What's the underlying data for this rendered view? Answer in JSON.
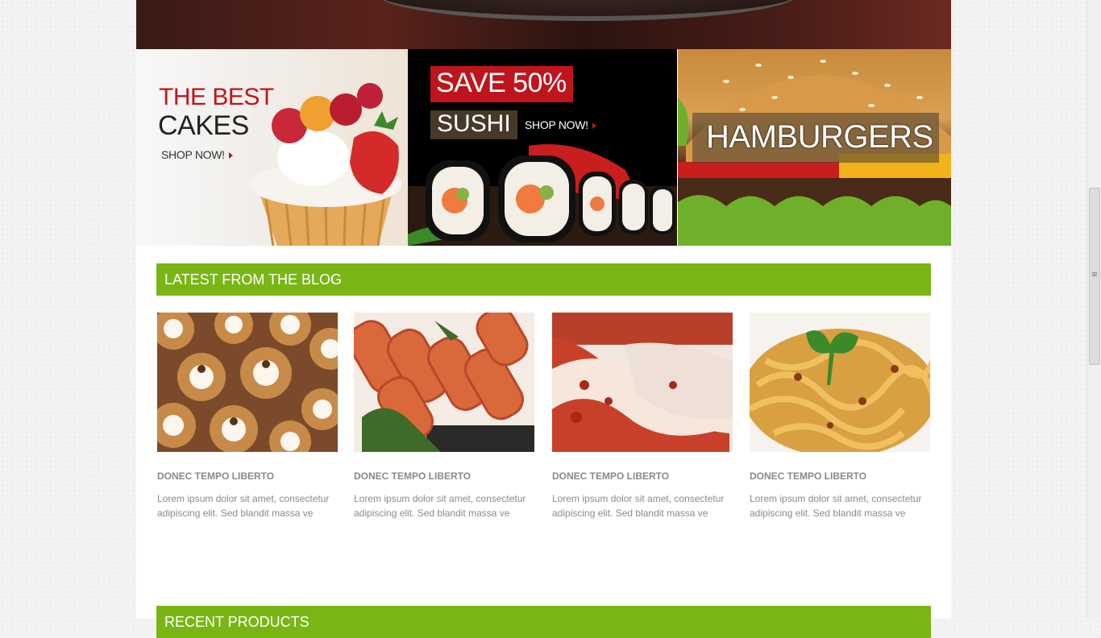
{
  "banners": {
    "cakes": {
      "line1": "THE BEST",
      "line2": "CAKES",
      "cta": "SHOP NOW!"
    },
    "sushi": {
      "badge": "SAVE 50%",
      "title": "SUSHI",
      "cta": "SHOP NOW!"
    },
    "burgers": {
      "title": "HAMBURGERS"
    }
  },
  "blog": {
    "heading": "LATEST FROM THE BLOG",
    "posts": [
      {
        "title": "DONEC TEMPO LIBERTO",
        "excerpt": "Lorem ipsum dolor sit amet, consectetur adipiscing elit. Sed blandit massa ve"
      },
      {
        "title": "DONEC TEMPO LIBERTO",
        "excerpt": "Lorem ipsum dolor sit amet, consectetur adipiscing elit. Sed blandit massa ve"
      },
      {
        "title": "DONEC TEMPO LIBERTO",
        "excerpt": "Lorem ipsum dolor sit amet, consectetur adipiscing elit. Sed blandit massa ve"
      },
      {
        "title": "DONEC TEMPO LIBERTO",
        "excerpt": "Lorem ipsum dolor sit amet, consectetur adipiscing elit. Sed blandit massa ve"
      }
    ]
  },
  "products": {
    "heading": "RECENT PRODUCTS"
  },
  "colors": {
    "accent": "#7ab516",
    "brand_red": "#c0141c"
  }
}
